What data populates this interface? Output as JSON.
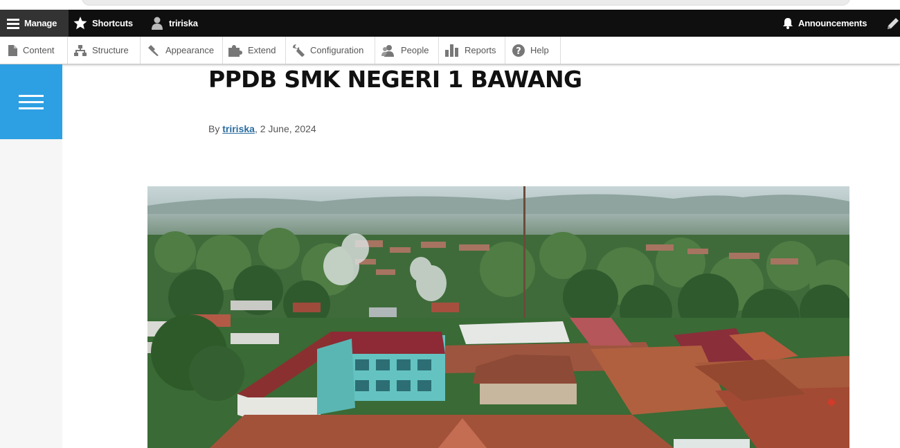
{
  "toolbar": {
    "manage": "Manage",
    "shortcuts": "Shortcuts",
    "user": "tririska",
    "announcements": "Announcements"
  },
  "tray": {
    "items": [
      "Content",
      "Structure",
      "Appearance",
      "Extend",
      "Configuration",
      "People",
      "Reports",
      "Help"
    ]
  },
  "article": {
    "title": "PPDB SMK NEGERI 1 BAWANG",
    "by": "By",
    "author": "tririska",
    "date": ", 2 June, 2024"
  },
  "colors": {
    "toolbar_bg": "#0f0f0f",
    "manage_bg": "#333333",
    "accent": "#2d9fe3",
    "link": "#2a6ca0"
  }
}
